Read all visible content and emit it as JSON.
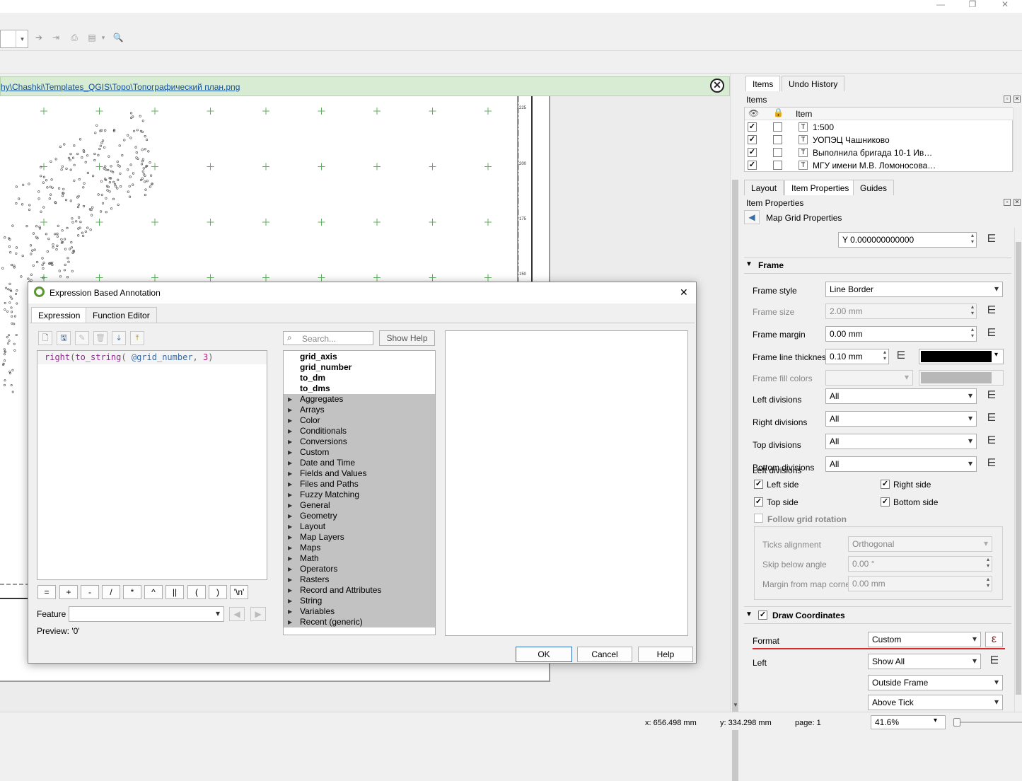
{
  "window": {
    "min": "—",
    "restore": "❐",
    "close": "✕"
  },
  "message_bar": {
    "path": "hy\\Chashki\\Templates_QGIS\\Topo\\Топографический план.png",
    "close": "✕"
  },
  "map": {
    "scale_ticks": [
      "225",
      "200",
      "175",
      "150"
    ]
  },
  "right_panel": {
    "top_tabs": [
      "Items",
      "Undo History"
    ],
    "items_title": "Items",
    "items_header": "Item",
    "items": [
      {
        "label": "1:500",
        "visible": "✓"
      },
      {
        "label": "УОПЭЦ Чашниково",
        "visible": "✓"
      },
      {
        "label": "Выполнила бригада 10-1 Ив…",
        "visible": "✓"
      },
      {
        "label": "МГУ имени М.В. Ломоносова…",
        "visible": "✓"
      }
    ],
    "item_icon": "T",
    "tabs": [
      "Layout",
      "Item Properties",
      "Guides"
    ],
    "item_props_title": "Item Properties",
    "back_label": "Map Grid Properties",
    "offset_y": "Y 0.000000000000",
    "frame_section": "Frame",
    "frame": {
      "style_label": "Frame style",
      "style_value": "Line Border",
      "size_label": "Frame size",
      "size_value": "2.00 mm",
      "margin_label": "Frame margin",
      "margin_value": "0.00 mm",
      "thickness_label": "Frame line thickness",
      "thickness_value": "0.10 mm",
      "line_color": "#000000",
      "fill_label": "Frame fill colors",
      "left_div_label": "Left divisions",
      "left_div_value": "All",
      "right_div_label": "Right divisions",
      "right_div_value": "All",
      "top_div_label": "Top divisions",
      "top_div_value": "All",
      "bottom_div_label": "Bottom divisions",
      "bottom_div_value": "All",
      "left_side": "Left side",
      "right_side": "Right side",
      "top_side": "Top side",
      "bottom_side": "Bottom side",
      "follow_rotation": "Follow grid rotation",
      "ticks_alignment_label": "Ticks alignment",
      "ticks_alignment_value": "Orthogonal",
      "skip_below_label": "Skip below angle",
      "skip_below_value": "0.00 °",
      "margin_corner_label": "Margin from map corner",
      "margin_corner_value": "0.00 mm"
    },
    "draw_coords_section": "Draw Coordinates",
    "coords": {
      "format_label": "Format",
      "format_value": "Custom",
      "left_label": "Left",
      "left_value": "Show All",
      "position_value": "Outside Frame",
      "direction_value": "Above Tick"
    },
    "check": "✓",
    "dd_icon": "⋿",
    "epsilon": "ε"
  },
  "status": {
    "x": "x: 656.498 mm",
    "y": "y: 334.298 mm",
    "page": "page: 1",
    "zoom": "41.6%"
  },
  "dialog": {
    "title": "Expression Based Annotation",
    "close": "✕",
    "tabs": [
      "Expression",
      "Function Editor"
    ],
    "expression_parts": [
      "right",
      "(",
      "to_string",
      "( ",
      "@grid_number",
      ", ",
      "3",
      ")"
    ],
    "operators": [
      "=",
      "+",
      "-",
      "/",
      "*",
      "^",
      "||",
      "(",
      ")",
      "'\\n'"
    ],
    "feature_label": "Feature",
    "preview_label": "Preview:",
    "preview_value": "'0'",
    "search_placeholder": "Search...",
    "show_help": "Show Help",
    "functions": [
      "grid_axis",
      "grid_number",
      "to_dm",
      "to_dms"
    ],
    "groups": [
      "Aggregates",
      "Arrays",
      "Color",
      "Conditionals",
      "Conversions",
      "Custom",
      "Date and Time",
      "Fields and Values",
      "Files and Paths",
      "Fuzzy Matching",
      "General",
      "Geometry",
      "Layout",
      "Map Layers",
      "Maps",
      "Math",
      "Operators",
      "Rasters",
      "Record and Attributes",
      "String",
      "Variables",
      "Recent (generic)"
    ],
    "ok": "OK",
    "cancel": "Cancel",
    "help": "Help"
  }
}
